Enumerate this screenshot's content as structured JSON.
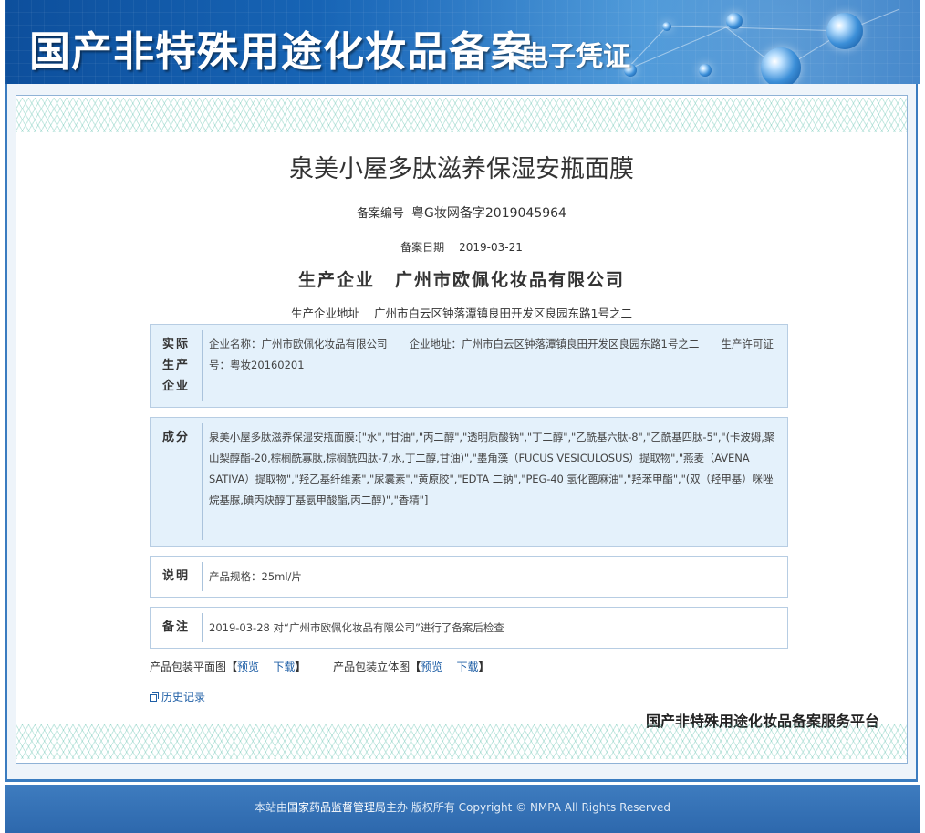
{
  "header": {
    "title": "国产非特殊用途化妆品备案",
    "subtitle": "电子凭证"
  },
  "certificate": {
    "product_name": "泉美小屋多肽滋养保湿安瓶面膜",
    "reg_no_label": "备案编号",
    "reg_no": "粤G妆网备字2019045964",
    "date_label": "备案日期",
    "date": "2019-03-21",
    "enterprise_label": "生产企业",
    "enterprise": "广州市欧佩化妆品有限公司",
    "address_label": "生产企业地址",
    "address": "广州市白云区钟落潭镇良田开发区良园东路1号之二"
  },
  "actual_producer": {
    "heading_1": "实际",
    "heading_2": "生产",
    "heading_3": "企业",
    "name_text": "企业名称：广州市欧佩化妆品有限公司",
    "addr_text": "企业地址：广州市白云区钟落潭镇良田开发区良园东路1号之二",
    "license_text": "生产许可证号：粤妆20160201"
  },
  "ingredients": {
    "heading": "成分",
    "text": "泉美小屋多肽滋养保湿安瓶面膜:[\"水\",\"甘油\",\"丙二醇\",\"透明质酸钠\",\"丁二醇\",\"乙酰基六肽-8\",\"乙酰基四肽-5\",\"(卡波姆,聚山梨醇酯-20,棕榈酰寡肽,棕榈酰四肽-7,水,丁二醇,甘油)\",\"墨角藻（FUCUS VESICULOSUS）提取物\",\"燕麦（AVENA SATIVA）提取物\",\"羟乙基纤维素\",\"尿囊素\",\"黄原胶\",\"EDTA 二钠\",\"PEG-40 氢化蓖麻油\",\"羟苯甲酯\",\"(双（羟甲基）咪唑烷基脲,碘丙炔醇丁基氨甲酸酯,丙二醇)\",\"香精\"]"
  },
  "description": {
    "heading": "说明",
    "text": "产品规格：25ml/片"
  },
  "remarks": {
    "heading": "备注",
    "text": "2019-03-28 对“广州市欧佩化妆品有限公司”进行了备案后检查"
  },
  "images": {
    "flat_label": "产品包装平面图",
    "solid_label": "产品包装立体图",
    "bracket_open": "【",
    "bracket_close": "】",
    "preview": "预览",
    "download": "下载"
  },
  "history_label": "历史记录",
  "platform_label": "国产非特殊用途化妆品备案服务平台",
  "footer": {
    "prefix": "本站由",
    "org": "国家药品监督管理局",
    "suffix": "主办 版权所有 Copyright © NMPA All Rights Reserved"
  },
  "colors": {
    "banner": "#1a6bbd",
    "frame_border": "#3a7cc0",
    "box_blue": "#e4f1fb",
    "link": "#1f5fa6",
    "footer": "#3e7cbf"
  }
}
